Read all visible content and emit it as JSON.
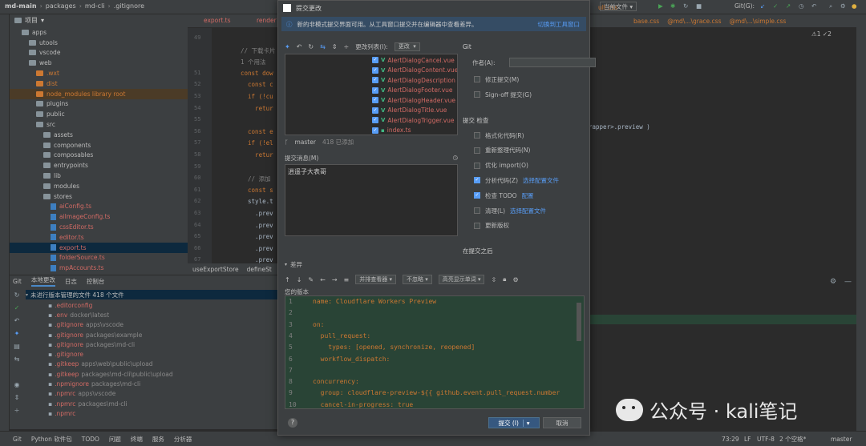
{
  "breadcrumb": [
    "md-main",
    "packages",
    "md-cli",
    ".gitignore"
  ],
  "project": {
    "header": "项目",
    "rows": [
      {
        "label": "apps",
        "type": "folder",
        "indent": 1
      },
      {
        "label": "utools",
        "type": "folder",
        "indent": 2
      },
      {
        "label": "vscode",
        "type": "folder",
        "indent": 2
      },
      {
        "label": "web",
        "type": "folder",
        "indent": 2
      },
      {
        "label": ".wxt",
        "type": "folder",
        "indent": 3,
        "color": "#cc7832"
      },
      {
        "label": "dist",
        "type": "folder",
        "indent": 3,
        "color": "#cc7832"
      },
      {
        "label": "node_modules  library root",
        "type": "folder",
        "indent": 3,
        "color": "#cc7832",
        "highlight": true
      },
      {
        "label": "plugins",
        "type": "folder",
        "indent": 3
      },
      {
        "label": "public",
        "type": "folder",
        "indent": 3
      },
      {
        "label": "src",
        "type": "folder",
        "indent": 3
      },
      {
        "label": "assets",
        "type": "folder",
        "indent": 4
      },
      {
        "label": "components",
        "type": "folder",
        "indent": 4
      },
      {
        "label": "composables",
        "type": "folder",
        "indent": 4
      },
      {
        "label": "entrypoints",
        "type": "folder",
        "indent": 4
      },
      {
        "label": "lib",
        "type": "folder",
        "indent": 4
      },
      {
        "label": "modules",
        "type": "folder",
        "indent": 4
      },
      {
        "label": "stores",
        "type": "folder",
        "indent": 4
      },
      {
        "label": "aiConfig.ts",
        "type": "ts",
        "indent": 5
      },
      {
        "label": "aiImageConfig.ts",
        "type": "ts",
        "indent": 5
      },
      {
        "label": "cssEditor.ts",
        "type": "ts",
        "indent": 5
      },
      {
        "label": "editor.ts",
        "type": "ts",
        "indent": 5
      },
      {
        "label": "export.ts",
        "type": "ts",
        "indent": 5,
        "selected": true
      },
      {
        "label": "folderSource.ts",
        "type": "ts",
        "indent": 5
      },
      {
        "label": "mpAccounts.ts",
        "type": "ts",
        "indent": 5
      }
    ]
  },
  "editor_tabs": [
    "export.ts",
    "render",
    "ult.css",
    "base.css",
    "@md\\...\\grace.css",
    "@md\\...\\simple.css"
  ],
  "editor": {
    "lines": [
      {
        "n": "49",
        "code": ""
      },
      {
        "n": "",
        "code": "// 下载卡片"
      },
      {
        "n": "",
        "code": "1 个用法"
      },
      {
        "n": "51",
        "code": "const dow"
      },
      {
        "n": "52",
        "code": "  const c"
      },
      {
        "n": "53",
        "code": "  if (!cu"
      },
      {
        "n": "54",
        "code": "    retur"
      },
      {
        "n": "55",
        "code": ""
      },
      {
        "n": "56",
        "code": "  const e"
      },
      {
        "n": "57",
        "code": "  if (!el"
      },
      {
        "n": "58",
        "code": "    retur"
      },
      {
        "n": "59",
        "code": ""
      },
      {
        "n": "60",
        "code": "  // 添加"
      },
      {
        "n": "61",
        "code": "  const s"
      },
      {
        "n": "62",
        "code": "  style.t"
      },
      {
        "n": "63",
        "code": "    .prev"
      },
      {
        "n": "64",
        "code": "    .prev"
      },
      {
        "n": "65",
        "code": "    .prev"
      },
      {
        "n": "66",
        "code": "    .prev"
      },
      {
        "n": "67",
        "code": "    .prev"
      }
    ],
    "right_snippet": "rapper>.preview )",
    "warnings": "⚠1 ✓2",
    "status_fn": "useExportStore",
    "status_fn2": "defineSt"
  },
  "git_panel": {
    "tabs": [
      "Git",
      "本地更改",
      "日志",
      "控制台"
    ],
    "group_label": "未进行版本管理的文件  418 个文件",
    "rows": [
      {
        "name": ".editorconfig",
        "path": ""
      },
      {
        "name": ".env",
        "path": "docker\\latest"
      },
      {
        "name": ".gitignore",
        "path": "apps\\vscode"
      },
      {
        "name": ".gitignore",
        "path": "packages\\example"
      },
      {
        "name": ".gitignore",
        "path": "packages\\md-cli"
      },
      {
        "name": ".gitignore",
        "path": ""
      },
      {
        "name": ".gitkeep",
        "path": "apps\\web\\public\\upload"
      },
      {
        "name": ".gitkeep",
        "path": "packages\\md-cli\\public\\upload"
      },
      {
        "name": ".npmignore",
        "path": "packages\\md-cli"
      },
      {
        "name": ".npmrc",
        "path": "apps\\vscode"
      },
      {
        "name": ".npmrc",
        "path": "packages\\md-cli"
      },
      {
        "name": ".npmrc",
        "path": ""
      }
    ]
  },
  "dialog": {
    "title": "提交更改",
    "banner_text": "新的非模式提交界面可用。从工具窗口提交并在编辑器中查看差异。",
    "banner_link": "切换到工具窗口",
    "changelist_label": "更改列表(I):",
    "changelist_value": "更改",
    "files": [
      "AlertDialogCancel.vue",
      "AlertDialogContent.vue",
      "AlertDialogDescription",
      "AlertDialogFooter.vue",
      "AlertDialogHeader.vue",
      "AlertDialogTitle.vue",
      "AlertDialogTrigger.vue",
      "index.ts"
    ],
    "branch": "master",
    "added": "418 已添加",
    "msg_label": "提交消息(M)",
    "message": "逍遥子大表哥",
    "git_title": "Git",
    "author_label": "作者(A):",
    "amend": "修正提交(M)",
    "signoff": "Sign-off 提交(G)",
    "check_title": "提交 检查",
    "checks": [
      {
        "label": "格式化代码(R)",
        "checked": false,
        "link": ""
      },
      {
        "label": "重新整理代码(N)",
        "checked": false,
        "link": ""
      },
      {
        "label": "优化 import(O)",
        "checked": false,
        "link": ""
      },
      {
        "label": "分析代码(Z)",
        "checked": true,
        "link": "选择配置文件"
      },
      {
        "label": "检查 TODO",
        "checked": true,
        "link": "配置"
      },
      {
        "label": "清理(L)",
        "checked": false,
        "link": "选择配置文件"
      },
      {
        "label": "更新版权",
        "checked": false,
        "link": ""
      }
    ],
    "after_title": "在提交之后",
    "diff_label": "差异",
    "viewer": "并排查看器",
    "ignore": "不忽略",
    "highlight": "高亮显示单词",
    "your_version": "您的版本",
    "diff_lines": [
      {
        "n": "1",
        "code": "name: Cloudflare Workers Preview"
      },
      {
        "n": "2",
        "code": ""
      },
      {
        "n": "3",
        "code": "on:"
      },
      {
        "n": "4",
        "code": "  pull_request:"
      },
      {
        "n": "5",
        "code": "    types: [opened, synchronize, reopened]"
      },
      {
        "n": "6",
        "code": "  workflow_dispatch:"
      },
      {
        "n": "7",
        "code": ""
      },
      {
        "n": "8",
        "code": "concurrency:"
      },
      {
        "n": "9",
        "code": "  group: cloudflare-preview-${{ github.event.pull_request.number"
      },
      {
        "n": "10",
        "code": "  cancel-in-progress: true"
      }
    ],
    "commit_btn": "提交 (I)",
    "cancel_btn": "取消",
    "help": "?"
  },
  "top_right": {
    "current_file": "当前文件",
    "git": "Git(G):"
  },
  "statusbar": {
    "items": [
      "Git",
      "Python 软件包",
      "TODO",
      "问题",
      "终端",
      "服务",
      "分析器"
    ],
    "position": "73:29",
    "lf": "LF",
    "enc": "UTF-8",
    "indent": "2 个空格*",
    "branch": "master"
  },
  "watermark": "公众号 · kali笔记"
}
